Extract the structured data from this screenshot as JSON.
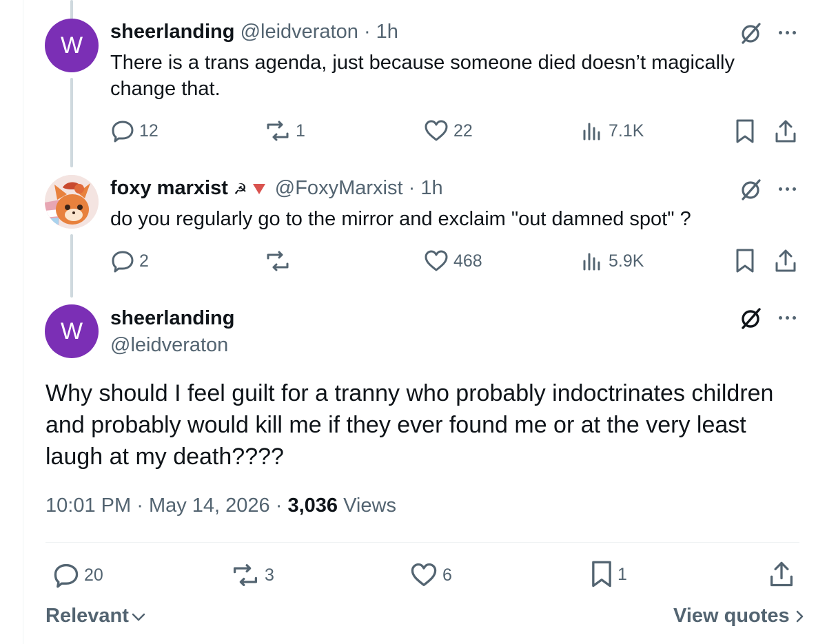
{
  "tweets": [
    {
      "avatar_letter": "W",
      "display_name": "sheerlanding",
      "handle": "@leidveraton",
      "time": "1h",
      "text": "There is a trans agenda, just because someone died doesn’t magically change that.",
      "replies": "12",
      "reposts": "1",
      "likes": "22",
      "views": "7.1K"
    },
    {
      "avatar_icon": "fox-avatar-icon",
      "display_name": "foxy marxist",
      "name_badges": [
        "hammer-sickle-icon",
        "red-triangle-icon"
      ],
      "handle": "@FoxyMarxist",
      "time": "1h",
      "text": "do you regularly go to the mirror and exclaim \"out damned spot\" ?",
      "replies": "2",
      "reposts": "",
      "likes": "468",
      "views": "5.9K"
    }
  ],
  "main_tweet": {
    "avatar_letter": "W",
    "display_name": "sheerlanding",
    "handle": "@leidveraton",
    "text": "Why should I feel guilt for a tranny who probably indoctrinates children and probably would kill me if they ever found me or at the very least laugh at my death????",
    "time": "10:01 PM",
    "date": "May 14, 2026",
    "views_count": "3,036",
    "views_label": "Views",
    "replies": "20",
    "reposts": "3",
    "likes": "6",
    "bookmarks": "1"
  },
  "footer": {
    "sort_label": "Relevant",
    "view_quotes_label": "View quotes"
  },
  "separator": "·",
  "colors": {
    "avatar_purple": "#7b2fb5",
    "muted_text": "#536471",
    "primary_text": "#0f1419",
    "thread_line": "#cfd9de"
  }
}
